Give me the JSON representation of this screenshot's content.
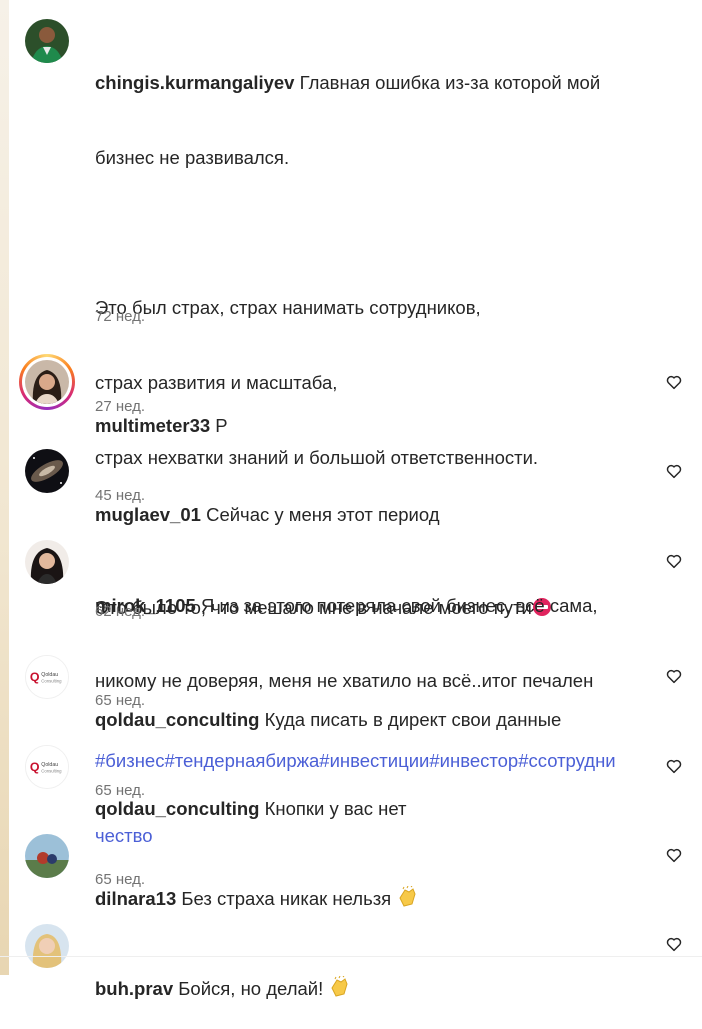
{
  "caption": {
    "username": "chingis.kurmangaliyev",
    "line1": " Главная ошибка из-за которой мой",
    "line2": "бизнес не развивался.",
    "line3": "Это был страх, страх нанимать сотрудников,",
    "line4": "страх развития и масштаба,",
    "line5": "страх нехватки знаний и большой ответственности.",
    "line6": "Это было то, что мешало мне в начале моего пути",
    "hashtags_line1": "#бизнес#тендернаябиржа#инвестиции#инвестор#ссотрудни",
    "hashtags_line2": "чество",
    "time": "72 нед."
  },
  "comments": [
    {
      "username": "multimeter33",
      "text": " P",
      "time": "27 нед."
    },
    {
      "username": "muglaev_01",
      "text": " Сейчас у меня этот период",
      "time": "45 нед."
    },
    {
      "username": "mirok_1105",
      "text": " Я из за этого потеряла свой бизнес, всё сама,",
      "text2": "никому не доверяя, меня не хватило на всё..итог печален",
      "time": "62 нед."
    },
    {
      "username": "qoldau_conculting",
      "text": " Куда писать в директ свои данные",
      "time": "65 нед.",
      "avatar_logo_top": "Qoldau",
      "avatar_logo_bottom": "Consulting"
    },
    {
      "username": "qoldau_conculting",
      "text": " Кнопки у вас нет",
      "time": "65 нед.",
      "avatar_logo_top": "Qoldau",
      "avatar_logo_bottom": "Consulting"
    },
    {
      "username": "dilnara13",
      "text": " Без страха никак нельзя ",
      "time": "65 нед."
    },
    {
      "username": "buh.prav",
      "text": " Бойся, но делай! "
    }
  ],
  "icons": {
    "heart": "heart-outline-icon",
    "no_entry": "no-entry-emoji",
    "clap": "clapping-hands-emoji"
  },
  "colors": {
    "hashtag": "#4b5fd6",
    "meta": "#737373",
    "text": "#262626"
  }
}
